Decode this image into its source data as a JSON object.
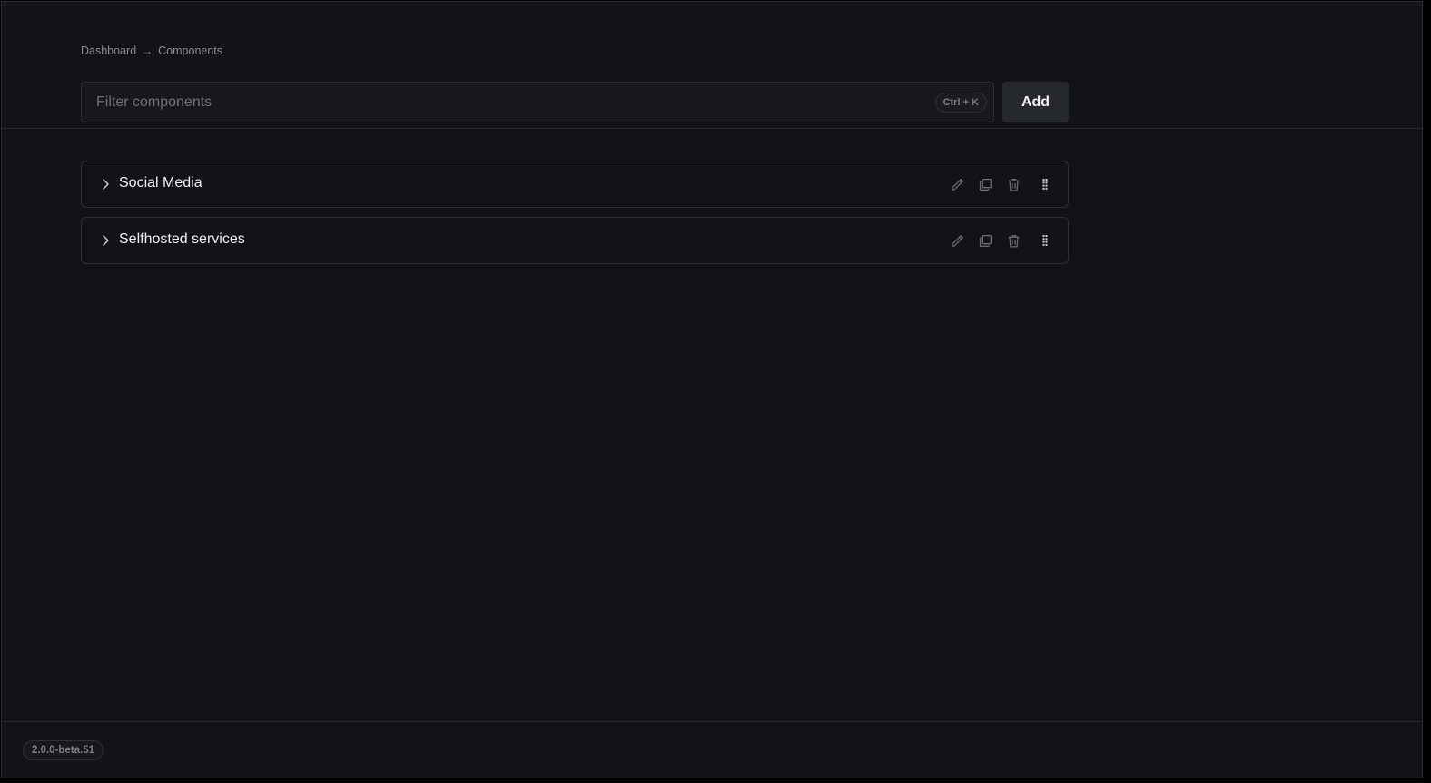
{
  "breadcrumb": {
    "items": [
      "Dashboard",
      "Components"
    ],
    "separator": "→"
  },
  "search": {
    "placeholder": "Filter components",
    "value": "",
    "shortcut": "Ctrl + K"
  },
  "toolbar": {
    "add_label": "Add"
  },
  "groups": [
    {
      "title": "Social Media",
      "expanded": false
    },
    {
      "title": "Selfhosted services",
      "expanded": false
    }
  ],
  "icons": {
    "expand": "chevron-right-icon",
    "edit": "pencil-icon",
    "copy": "copy-icon",
    "delete": "trash-icon",
    "drag": "drag-handle-icon"
  },
  "footer": {
    "version": "2.0.0-beta.51"
  },
  "colors": {
    "background": "#111316",
    "border": "#2c2f33",
    "button_bg": "#25282c",
    "text": "#e6e7e9",
    "muted": "#8b8f95"
  }
}
